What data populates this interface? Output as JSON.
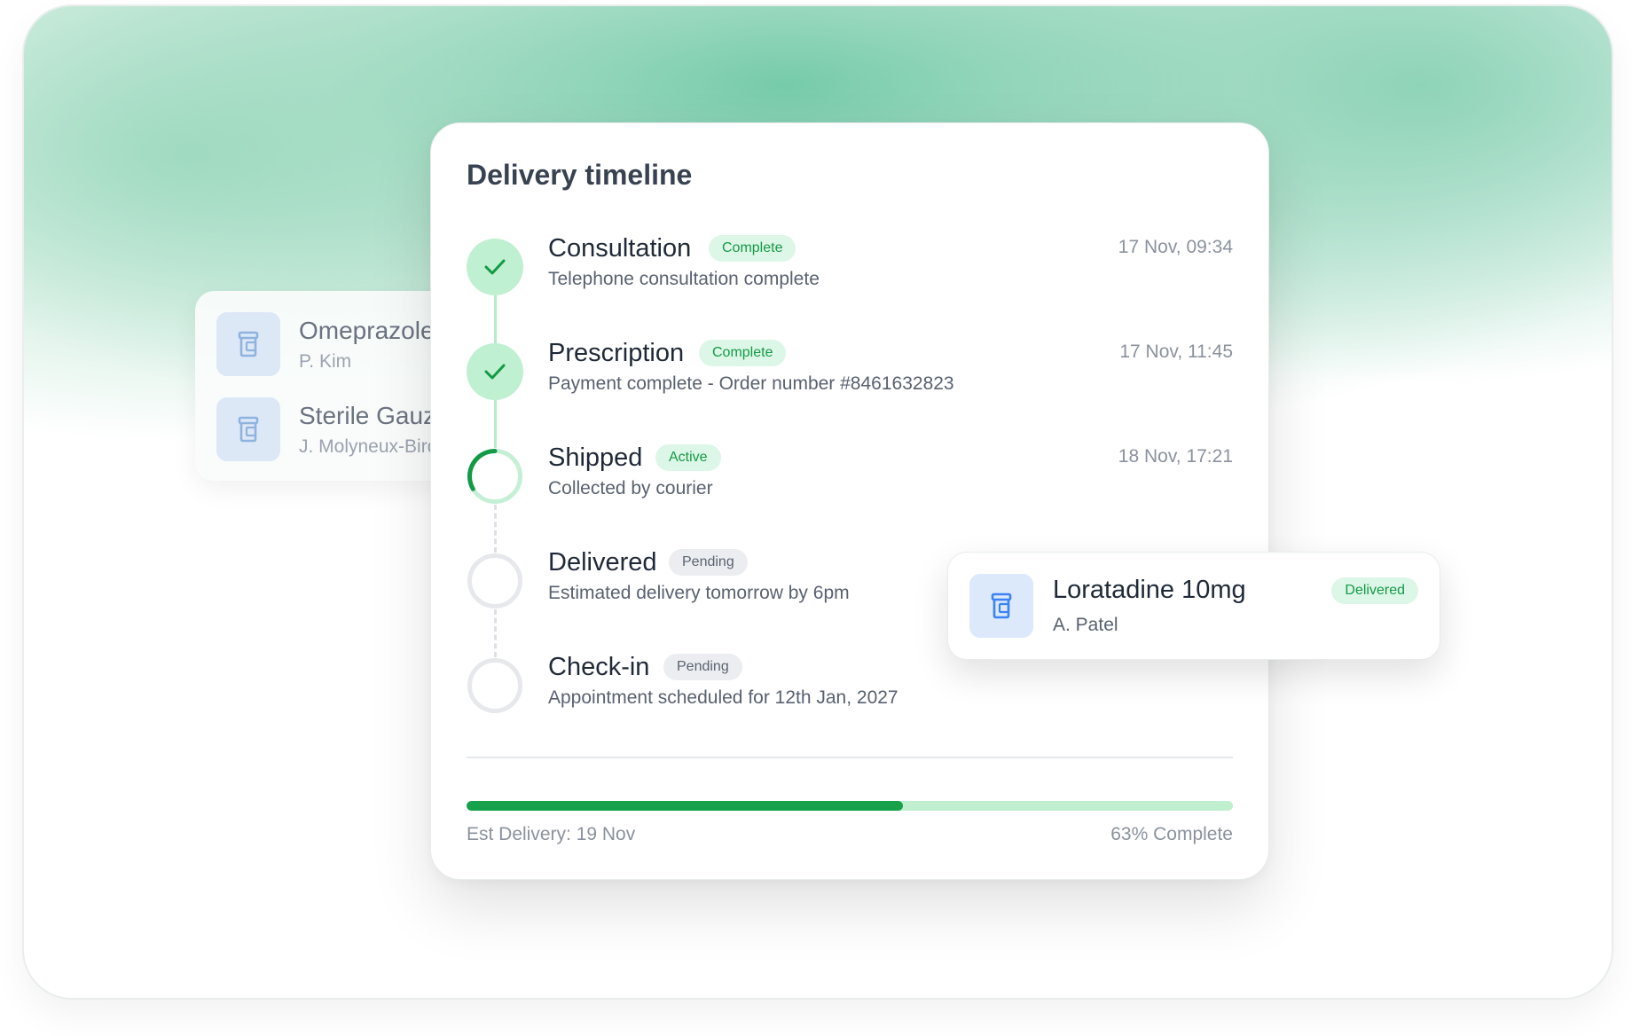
{
  "colors": {
    "accent_green": "#18a14b",
    "light_green": "#bfefcf",
    "badge_green_bg": "#dcf7e7",
    "pending_grey": "#ebedf0",
    "pill_blue": "#dbe9fb",
    "icon_blue": "#3b82f6"
  },
  "back_list": {
    "items": [
      {
        "name": "Omeprazole",
        "sub": "P. Kim",
        "icon": "pill-bottle-icon"
      },
      {
        "name": "Sterile Gauze",
        "sub": "J. Molyneux-Bird",
        "icon": "pill-bottle-icon"
      }
    ]
  },
  "timeline": {
    "title": "Delivery timeline",
    "steps": [
      {
        "name": "Consultation",
        "status": "Complete",
        "desc": "Telephone consultation complete",
        "time": "17 Nov, 09:34",
        "state": "complete"
      },
      {
        "name": "Prescription",
        "status": "Complete",
        "desc": "Payment complete - Order number #8461632823",
        "time": "17 Nov, 11:45",
        "state": "complete"
      },
      {
        "name": "Shipped",
        "status": "Active",
        "desc": "Collected by courier",
        "time": "18 Nov, 17:21",
        "state": "active"
      },
      {
        "name": "Delivered",
        "status": "Pending",
        "desc": "Estimated delivery tomorrow by 6pm",
        "time": "",
        "state": "pending"
      },
      {
        "name": "Check-in",
        "status": "Pending",
        "desc": "Appointment scheduled for 12th Jan, 2027",
        "time": "",
        "state": "pending"
      }
    ],
    "progress": {
      "percent": 57,
      "left_label": "Est Delivery: 19 Nov",
      "right_label": "63% Complete"
    }
  },
  "floating_card": {
    "name": "Loratadine 10mg",
    "sub": "A. Patel",
    "status": "Delivered",
    "icon": "pill-bottle-icon"
  }
}
